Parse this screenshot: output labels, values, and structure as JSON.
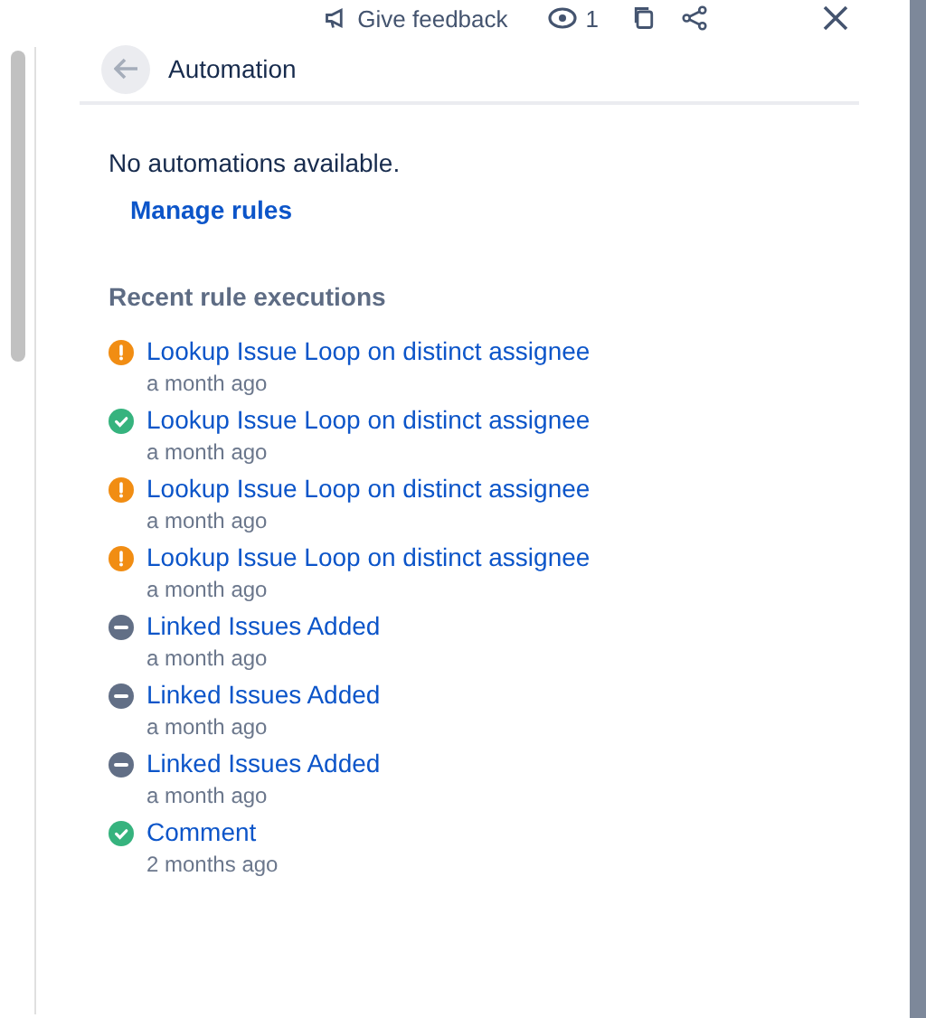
{
  "toolbar": {
    "feedback": "Give feedback",
    "watchers": "1"
  },
  "header": {
    "title": "Automation"
  },
  "empty_message": "No automations available.",
  "manage_link": "Manage rules",
  "section_title": "Recent rule executions",
  "executions": [
    {
      "kind": "warning",
      "name": "Lookup Issue Loop on distinct assignee",
      "time": "a month ago"
    },
    {
      "kind": "success",
      "name": "Lookup Issue Loop on distinct assignee",
      "time": "a month ago"
    },
    {
      "kind": "warning",
      "name": "Lookup Issue Loop on distinct assignee",
      "time": "a month ago"
    },
    {
      "kind": "warning",
      "name": "Lookup Issue Loop on distinct assignee",
      "time": "a month ago"
    },
    {
      "kind": "neutral",
      "name": "Linked Issues Added",
      "time": "a month ago"
    },
    {
      "kind": "neutral",
      "name": "Linked Issues Added",
      "time": "a month ago"
    },
    {
      "kind": "neutral",
      "name": "Linked Issues Added",
      "time": "a month ago"
    },
    {
      "kind": "success",
      "name": "Comment",
      "time": "2 months ago"
    }
  ]
}
